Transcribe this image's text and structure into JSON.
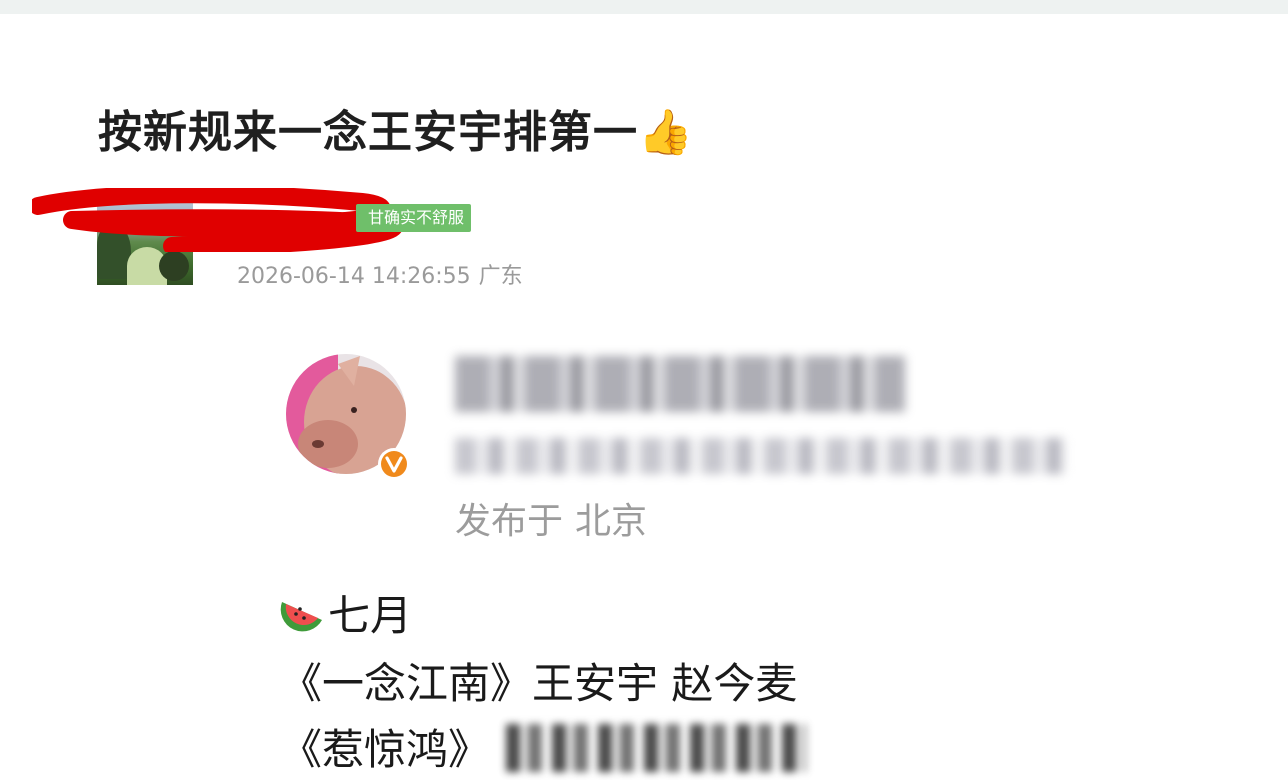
{
  "post": {
    "title": "按新规来一念王安宇排第一👍",
    "user_tag": "甘确实不舒服",
    "timestamp": "2026-06-14 14:26:55",
    "location": "广东"
  },
  "quoted": {
    "published_prefix": "发布于",
    "published_location": "北京",
    "lines": {
      "month": "七月",
      "show1_title": "《一念江南》",
      "show1_cast": "王安宇 赵今麦",
      "show2_title": "《惹惊鸿》"
    }
  },
  "icons": [
    "thumbs-up-icon",
    "verified-v-icon",
    "watermelon-icon"
  ],
  "colors": {
    "tag_bg": "#6fbf6a",
    "redaction": "#e00000",
    "verified": "#f08a1c"
  }
}
